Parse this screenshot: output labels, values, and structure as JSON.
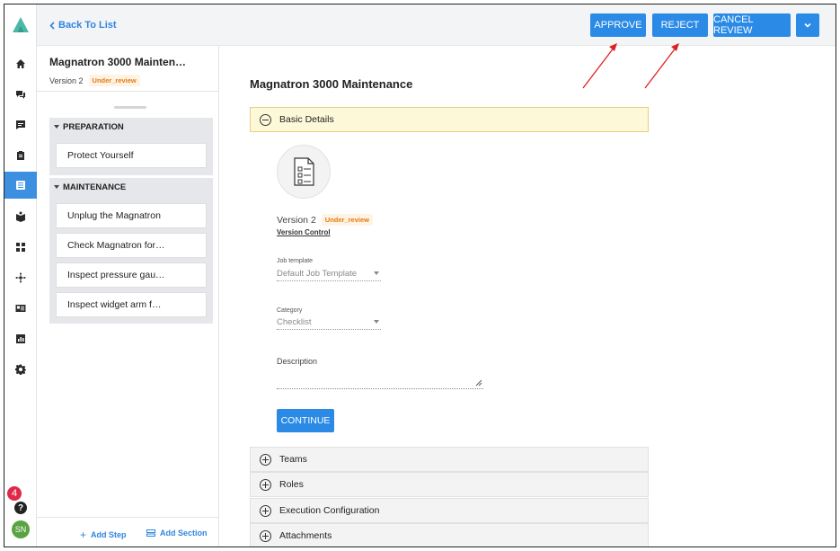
{
  "topbar": {
    "back_label": "Back To List",
    "approve_label": "APPROVE",
    "reject_label": "REJECT",
    "cancel_review_label": "CANCEL REVIEW"
  },
  "procedure": {
    "title": "Magnatron 3000 Mainten…",
    "version": "Version 2",
    "status": "Under_review"
  },
  "sections": [
    {
      "name": "PREPARATION",
      "steps": [
        "Protect Yourself"
      ]
    },
    {
      "name": "MAINTENANCE",
      "steps": [
        "Unplug the Magnatron",
        "Check Magnatron for…",
        "Inspect pressure gau…",
        "Inspect widget arm f…"
      ]
    }
  ],
  "footer": {
    "add_step": "Add Step",
    "add_section": "Add Section"
  },
  "main": {
    "title": "Magnatron 3000 Maintenance",
    "basic_details": "Basic Details",
    "version": "Version 2",
    "status": "Under_review",
    "version_control": "Version Control",
    "job_template_label": "Job template",
    "job_template_value": "Default Job Template",
    "category_label": "Category",
    "category_value": "Checklist",
    "description_label": "Description",
    "continue_label": "CONTINUE",
    "accordions": [
      "Teams",
      "Roles",
      "Execution Configuration",
      "Attachments"
    ]
  },
  "rail": {
    "notification_count": "4",
    "help": "?",
    "avatar_initials": "SN",
    "icons": [
      "home-icon",
      "chat-icon",
      "message-icon",
      "clipboard-icon",
      "checklist-icon",
      "book-icon",
      "dashboard-icon",
      "network-icon",
      "id-card-icon",
      "chart-icon",
      "gear-icon"
    ]
  },
  "colors": {
    "accent": "#2a8ae6",
    "status_tag_text": "#e07c12",
    "status_tag_bg": "#fff3e3",
    "annotation_arrow": "#e02020",
    "badge": "#e0284a",
    "avatar": "#5aa342"
  }
}
